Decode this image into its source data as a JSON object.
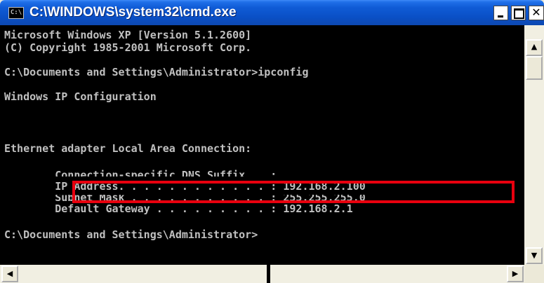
{
  "window": {
    "title": "C:\\WINDOWS\\system32\\cmd.exe",
    "icon_label": "C:\\",
    "close_glyph": "✕"
  },
  "console": {
    "lines": [
      "Microsoft Windows XP [Version 5.1.2600]",
      "(C) Copyright 1985-2001 Microsoft Corp.",
      "C:\\Documents and Settings\\Administrator>ipconfig",
      "Windows IP Configuration",
      "Ethernet adapter Local Area Connection:",
      "        Connection-specific DNS Suffix  . :",
      "        IP Address. . . . . . . . . . . . : 192.168.2.100",
      "        Subnet Mask . . . . . . . . . . . : 255.255.255.0",
      "        Default Gateway . . . . . . . . . : 192.168.2.1",
      "C:\\Documents and Settings\\Administrator>"
    ]
  },
  "colors": {
    "console_bg": "#000000",
    "console_text": "#c0c0c0",
    "titlebar": "#0a4fc5",
    "highlight": "#e8000e"
  },
  "icons": [
    "cmd-app-icon",
    "minimize-icon",
    "maximize-icon",
    "close-icon",
    "arrow-up-icon",
    "arrow-down-icon",
    "arrow-left-icon",
    "arrow-right-icon"
  ],
  "scroll_glyphs": {
    "up": "▲",
    "down": "▼",
    "left": "◀",
    "right": "▶"
  }
}
